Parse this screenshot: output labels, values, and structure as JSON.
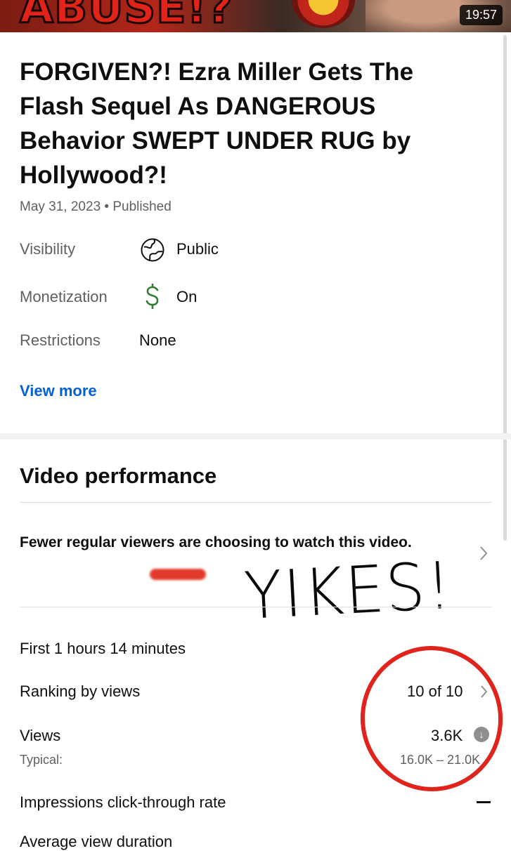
{
  "thumbnail": {
    "overlay_text": "ABUSE!?",
    "duration": "19:57"
  },
  "video": {
    "title": "FORGIVEN?! Ezra Miller Gets The Flash Sequel As DANGEROUS Behavior SWEPT UNDER RUG by Hollywood?!",
    "date": "May 31, 2023",
    "separator": "•",
    "status": "Published"
  },
  "details": {
    "visibility_label": "Visibility",
    "visibility_value": "Public",
    "visibility_icon": "globe-icon",
    "monetization_label": "Monetization",
    "monetization_value": "On",
    "monetization_icon": "dollar-icon",
    "monetization_color": "#2e7d32",
    "restrictions_label": "Restrictions",
    "restrictions_value": "None",
    "view_more": "View more",
    "link_color": "#065fd4"
  },
  "performance": {
    "title": "Video performance",
    "notice": "Fewer regular viewers are choosing to watch this video.",
    "period": "First 1 hours 14 minutes",
    "ranking_label": "Ranking by views",
    "ranking_value": "10 of 10",
    "views_label": "Views",
    "views_value": "3.6K",
    "views_icon": "arrow-down-circle-icon",
    "typical_label": "Typical:",
    "typical_range": "16.0K – 21.0K",
    "ctr_label": "Impressions click-through rate",
    "next_row_partial": "Average view duration"
  },
  "annotations": {
    "handwritten": "YIKES!",
    "circle_color": "#e0231b",
    "redaction_color": "#e23a2a"
  }
}
